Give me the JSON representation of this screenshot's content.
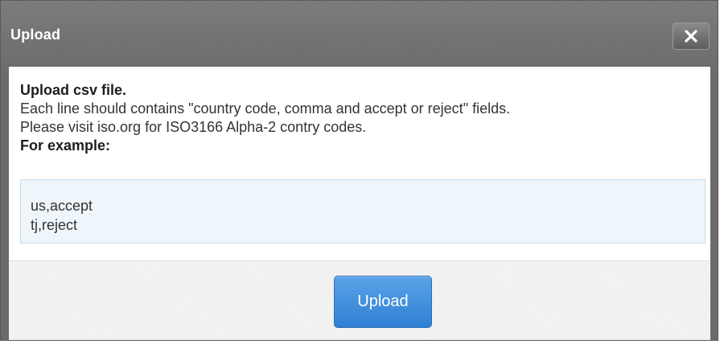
{
  "dialog": {
    "title": "Upload",
    "close_icon": "close-icon"
  },
  "content": {
    "heading": "Upload csv file.",
    "line1": "Each line should contains \"country code, comma and accept or reject\" fields.",
    "line2": "Please visit iso.org for ISO3166 Alpha-2 contry codes.",
    "example_label": "For example:",
    "example_lines": [
      "us,accept",
      "tj,reject"
    ]
  },
  "footer": {
    "upload_label": "Upload"
  },
  "colors": {
    "titlebar": "#6b6b6b",
    "button": "#3a8bdc",
    "example_bg": "#eef5fb"
  }
}
